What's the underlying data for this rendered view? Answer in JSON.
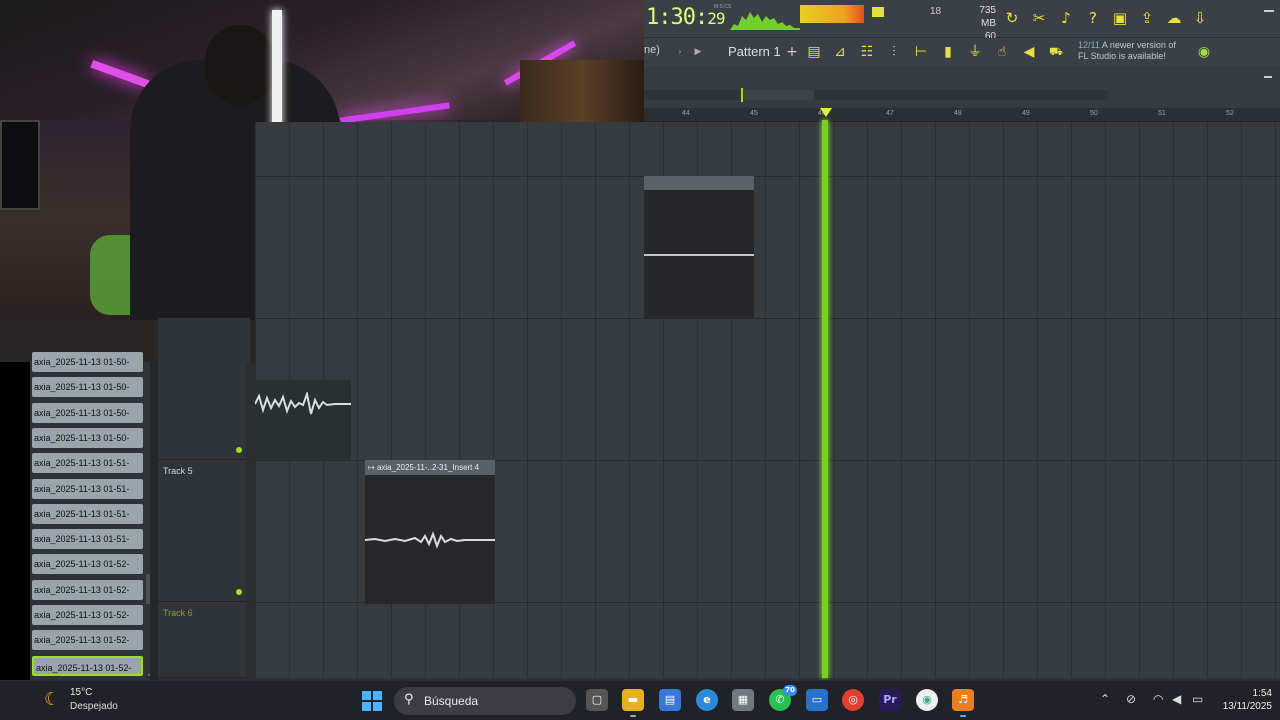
{
  "toolbar": {
    "time_main": "1:30:",
    "time_sec": "29",
    "time_units": "M:S:CS",
    "cpu_value": "18",
    "memory": "735 MB",
    "polyphony": "60"
  },
  "toolbar2": {
    "mode_label": "ne)",
    "pattern_label": "Pattern 1",
    "news_date": "12/11",
    "news_text_1": "A newer version of",
    "news_text_2": "FL Studio is available!"
  },
  "ruler": {
    "bars": [
      "44",
      "45",
      "46",
      "47",
      "48",
      "49",
      "50",
      "51",
      "52"
    ]
  },
  "browser": {
    "items": [
      "axia_2025-11-13 01-50-",
      "axia_2025-11-13 01-50-",
      "axia_2025-11-13 01-50-",
      "axia_2025-11-13 01-50-",
      "axia_2025-11-13 01-51-",
      "axia_2025-11-13 01-51-",
      "axia_2025-11-13 01-51-",
      "axia_2025-11-13 01-51-",
      "axia_2025-11-13 01-52-",
      "axia_2025-11-13 01-52-",
      "axia_2025-11-13 01-52-",
      "axia_2025-11-13 01-52-",
      "axia_2025-11-13 01-52-"
    ]
  },
  "tracks": {
    "track5": "Track 5",
    "track6": "Track 6"
  },
  "clips": {
    "clip_c_title": "axia_2025-11-..2-31_Insert 4"
  },
  "taskbar": {
    "weather_temp": "15°C",
    "weather_desc": "Despejado",
    "search_label": "Búsqueda",
    "whatsapp_badge": "70",
    "time": "1:54",
    "date": "13/11/2025"
  }
}
